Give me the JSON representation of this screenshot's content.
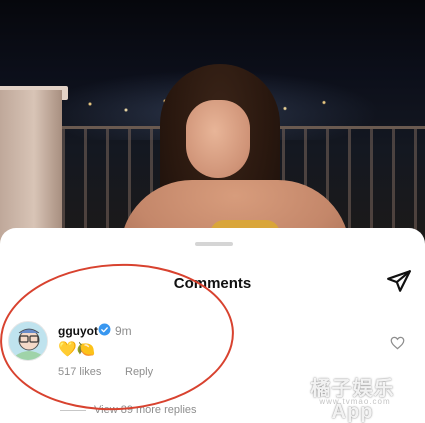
{
  "sheet": {
    "title": "Comments"
  },
  "comment": {
    "username": "gguyot",
    "time": "9m",
    "text": "💛🍋",
    "likes": "517 likes",
    "reply_label": "Reply",
    "view_replies": "View 89 more replies",
    "verified": true
  },
  "watermark": {
    "brand": "橘子娱乐App",
    "sub": "www.tvmao.com"
  },
  "colors": {
    "annotation": "#d8422f",
    "verified": "#3897f0",
    "muted_text": "#8e8e8e"
  },
  "icons": {
    "share": "paper-plane-icon",
    "like": "heart-icon",
    "verified": "verified-badge-icon"
  }
}
